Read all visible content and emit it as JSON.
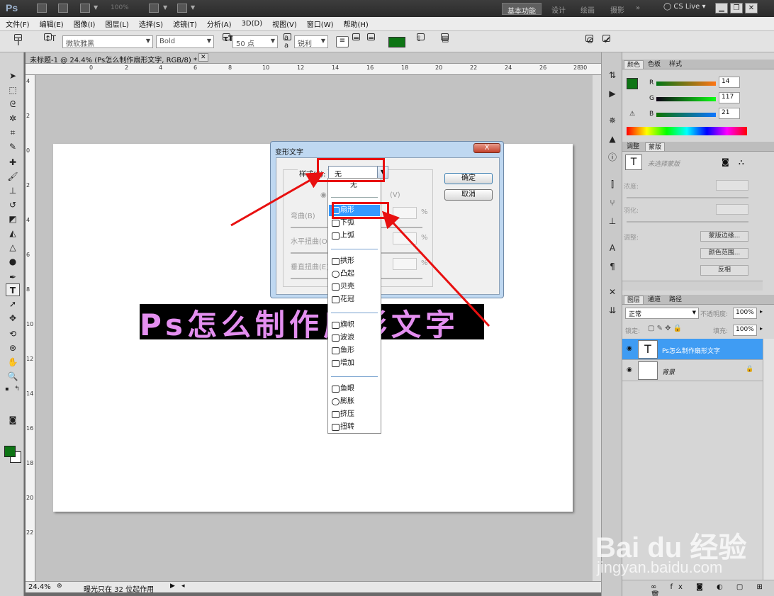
{
  "app": {
    "logo": "Ps",
    "zoom": "100%",
    "workspaces": [
      "基本功能",
      "设计",
      "绘画",
      "摄影"
    ],
    "active_workspace": "基本功能",
    "cslive": "CS Live"
  },
  "menu": [
    "文件(F)",
    "编辑(E)",
    "图像(I)",
    "图层(L)",
    "选择(S)",
    "滤镜(T)",
    "分析(A)",
    "3D(D)",
    "视图(V)",
    "窗口(W)",
    "帮助(H)"
  ],
  "options": {
    "font_family": "微软雅黑",
    "font_style": "Bold",
    "font_size": "50 点",
    "aa_label": "a a",
    "antialias": "锐利",
    "text_color": "#0e7515"
  },
  "document": {
    "tab_title": "未标题-1 @ 24.4% (Ps怎么制作扇形文字, RGB/8) *",
    "ruler_h": [
      "0",
      "2",
      "4",
      "6",
      "8",
      "10",
      "12",
      "14",
      "16",
      "18",
      "20",
      "22",
      "24",
      "26",
      "28",
      "30"
    ],
    "ruler_v": [
      "4",
      "2",
      "0",
      "2",
      "4",
      "6",
      "8",
      "10",
      "12",
      "14",
      "16",
      "18",
      "20",
      "22"
    ],
    "canvas_text": "Ps怎么制作扇形文字",
    "status_zoom": "24.4%",
    "status_text": "曝光只在 32 位起作用"
  },
  "warp_dialog": {
    "title": "变形文字",
    "close": "X",
    "style_label": "样式(S):",
    "style_value": "无",
    "orientation": "(V)",
    "bend": "弯曲(B)",
    "h_distort": "水平扭曲(O)",
    "v_distort": "垂直扭曲(E)",
    "pct": "%",
    "ok": "确定",
    "cancel": "取消"
  },
  "style_list": {
    "none": "无",
    "groups": [
      [
        "扇形",
        "下弧",
        "上弧"
      ],
      [
        "拱形",
        "凸起",
        "贝壳",
        "花冠"
      ],
      [
        "旗帜",
        "波浪",
        "鱼形",
        "增加"
      ],
      [
        "鱼眼",
        "膨胀",
        "挤压",
        "扭转"
      ]
    ],
    "selected": "扇形"
  },
  "panels": {
    "color_tabs": [
      "颜色",
      "色板",
      "样式"
    ],
    "rgb": {
      "R": "14",
      "G": "117",
      "B": "21"
    },
    "adjust_tabs": [
      "调整",
      "蒙版"
    ],
    "mask_placeholder": "未选择蒙版",
    "density": "浓度:",
    "feather": "羽化:",
    "refine": "调整:",
    "mask_edge": "蒙版边缘...",
    "color_range": "颜色范围...",
    "invert": "反相",
    "layer_tabs": [
      "图层",
      "通道",
      "路径"
    ],
    "blend_mode": "正常",
    "opacity_label": "不透明度:",
    "opacity": "100%",
    "lock_label": "锁定:",
    "fill_label": "填充:",
    "fill": "100%",
    "layers": [
      {
        "name": "Ps怎么制作扇形文字",
        "thumb": "T",
        "selected": true
      },
      {
        "name": "背景",
        "thumb": "",
        "selected": false
      }
    ]
  },
  "watermark": {
    "brand": "Bai du 经验",
    "url": "jingyan.baidu.com"
  }
}
